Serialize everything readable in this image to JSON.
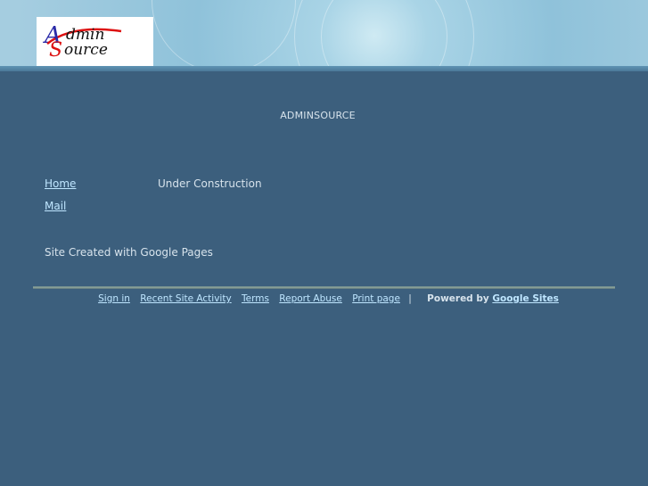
{
  "logo": {
    "line1": "dmin",
    "line2": "ource",
    "initial1": "A",
    "initial2": "S"
  },
  "site_title": "ADMINSOURCE",
  "nav": {
    "items": [
      "Home",
      "Mail"
    ]
  },
  "main": {
    "text": "Under Construction"
  },
  "credit": "Site Created with Google Pages",
  "footer": {
    "links": [
      "Sign in",
      "Recent Site Activity",
      "Terms",
      "Report Abuse",
      "Print page"
    ],
    "separator": "|",
    "powered_prefix": "Powered by",
    "powered_link": "Google Sites"
  },
  "colors": {
    "background": "#3c5f7d",
    "link": "#bfe6ff",
    "text": "#d7e3ec"
  }
}
